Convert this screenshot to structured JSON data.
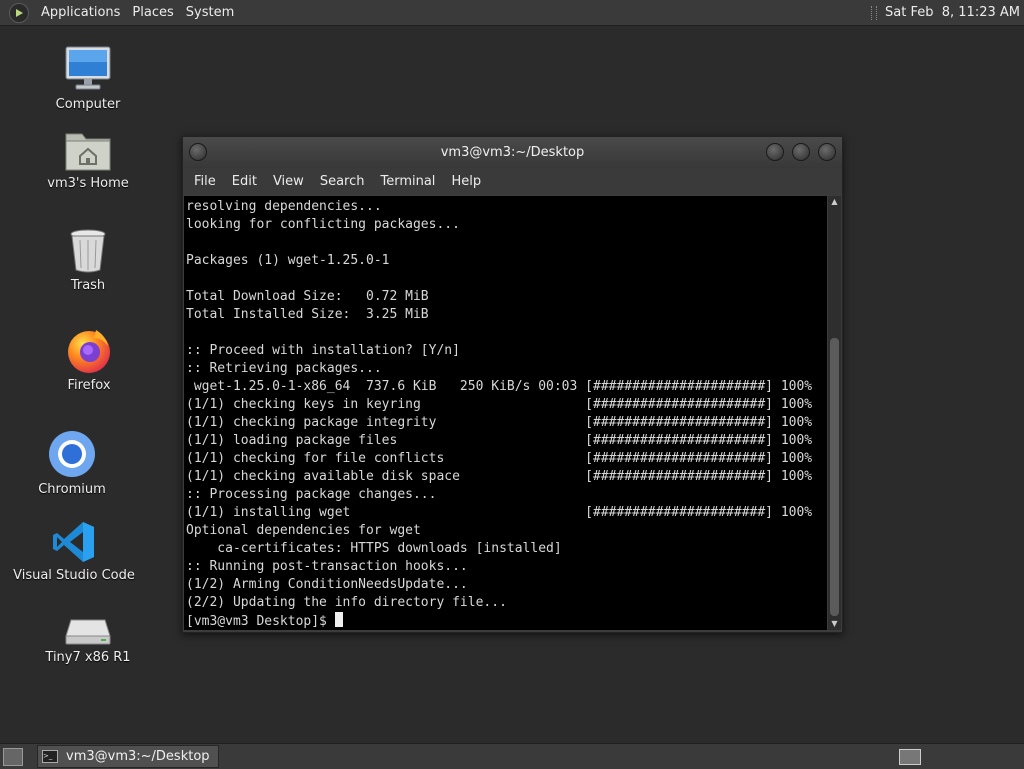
{
  "top_panel": {
    "menus": [
      "Applications",
      "Places",
      "System"
    ],
    "clock": "Sat Feb  8, 11:23 AM"
  },
  "desktop": {
    "icons": [
      {
        "label": "Computer",
        "icon": "computer-icon"
      },
      {
        "label": "vm3's Home",
        "icon": "home-folder-icon"
      },
      {
        "label": "Trash",
        "icon": "trash-icon"
      },
      {
        "label": "Firefox",
        "icon": "firefox-icon"
      },
      {
        "label": "Chromium",
        "icon": "chromium-icon"
      },
      {
        "label": "Visual Studio Code",
        "icon": "vscode-icon"
      },
      {
        "label": "Tiny7 x86 R1",
        "icon": "drive-icon"
      }
    ]
  },
  "terminal": {
    "title": "vm3@vm3:~/Desktop",
    "menus": [
      "File",
      "Edit",
      "View",
      "Search",
      "Terminal",
      "Help"
    ],
    "lines": [
      "resolving dependencies...",
      "looking for conflicting packages...",
      "",
      "Packages (1) wget-1.25.0-1",
      "",
      "Total Download Size:   0.72 MiB",
      "Total Installed Size:  3.25 MiB",
      "",
      ":: Proceed with installation? [Y/n]",
      ":: Retrieving packages...",
      " wget-1.25.0-1-x86_64  737.6 KiB   250 KiB/s 00:03 [######################] 100%",
      "(1/1) checking keys in keyring                     [######################] 100%",
      "(1/1) checking package integrity                   [######################] 100%",
      "(1/1) loading package files                        [######################] 100%",
      "(1/1) checking for file conflicts                  [######################] 100%",
      "(1/1) checking available disk space                [######################] 100%",
      ":: Processing package changes...",
      "(1/1) installing wget                              [######################] 100%",
      "Optional dependencies for wget",
      "    ca-certificates: HTTPS downloads [installed]",
      ":: Running post-transaction hooks...",
      "(1/2) Arming ConditionNeedsUpdate...",
      "(2/2) Updating the info directory file..."
    ],
    "prompt": "[vm3@vm3 Desktop]$ ",
    "scroll_position": 0.33
  },
  "bottom_panel": {
    "task_label": "vm3@vm3:~/Desktop"
  },
  "colors": {
    "desktop_bg": "#2b2b2b",
    "panel_bg": "#3a3a3a",
    "terminal_bg": "#000000",
    "terminal_fg": "#d8d8d8"
  }
}
